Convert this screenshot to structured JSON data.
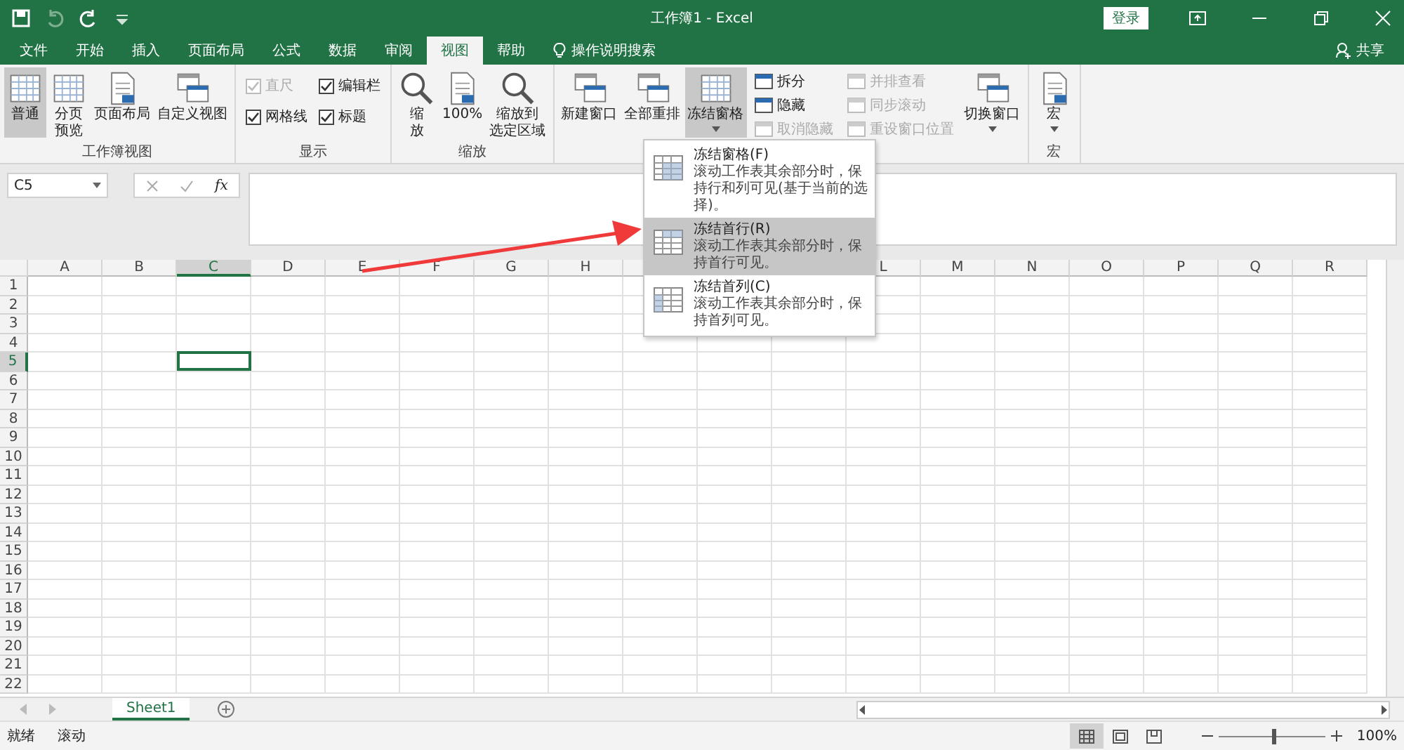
{
  "title_bar": {
    "title": "工作簿1 - Excel",
    "login": "登录"
  },
  "menu_tabs": [
    {
      "label": "文件",
      "selected": false
    },
    {
      "label": "开始",
      "selected": false
    },
    {
      "label": "插入",
      "selected": false
    },
    {
      "label": "页面布局",
      "selected": false
    },
    {
      "label": "公式",
      "selected": false
    },
    {
      "label": "数据",
      "selected": false
    },
    {
      "label": "审阅",
      "selected": false
    },
    {
      "label": "视图",
      "selected": true
    },
    {
      "label": "帮助",
      "selected": false
    }
  ],
  "tell_me": "操作说明搜索",
  "share": "共享",
  "ribbon": {
    "groups": [
      {
        "label": "工作簿视图",
        "items": [
          {
            "kind": "large",
            "label": "普通",
            "selected": true
          },
          {
            "kind": "large",
            "lines": [
              "分页",
              "预览"
            ],
            "selected": false
          },
          {
            "kind": "large",
            "label": "页面布局",
            "selected": false
          },
          {
            "kind": "large",
            "label": "自定义视图",
            "selected": false
          }
        ]
      },
      {
        "label": "显示",
        "items": [
          {
            "kind": "check",
            "label": "直尺",
            "checked": true,
            "disabled": true
          },
          {
            "kind": "check",
            "label": "编辑栏",
            "checked": true,
            "disabled": false
          },
          {
            "kind": "check",
            "label": "网格线",
            "checked": true,
            "disabled": false
          },
          {
            "kind": "check",
            "label": "标题",
            "checked": true,
            "disabled": false
          }
        ]
      },
      {
        "label": "缩放",
        "items": [
          {
            "kind": "large",
            "lines": [
              "缩",
              "放"
            ],
            "selected": false
          },
          {
            "kind": "large",
            "label": "100%",
            "selected": false
          },
          {
            "kind": "large",
            "lines": [
              "缩放到",
              "选定区域"
            ],
            "selected": false
          }
        ]
      },
      {
        "items": [
          {
            "kind": "large",
            "label": "新建窗口",
            "selected": false
          },
          {
            "kind": "large",
            "label": "全部重排",
            "selected": false
          },
          {
            "kind": "large",
            "label": "冻结窗格",
            "selected": true,
            "dropdown": true
          },
          {
            "kind": "stack",
            "items": [
              {
                "label": "拆分",
                "disabled": false
              },
              {
                "label": "隐藏",
                "disabled": false
              },
              {
                "label": "取消隐藏",
                "disabled": true
              }
            ]
          },
          {
            "kind": "stack",
            "items": [
              {
                "label": "并排查看",
                "disabled": true
              },
              {
                "label": "同步滚动",
                "disabled": true
              },
              {
                "label": "重设窗口位置",
                "disabled": true
              }
            ]
          },
          {
            "kind": "large",
            "label": "切换窗口",
            "selected": false,
            "dropdown": true
          }
        ]
      },
      {
        "label": "宏",
        "items": [
          {
            "kind": "large",
            "label": "宏",
            "selected": false,
            "dropdown": true
          }
        ]
      }
    ]
  },
  "formula_bar": {
    "name_box": "C5",
    "function_label": "fx"
  },
  "columns": [
    {
      "label": "A",
      "selected": false
    },
    {
      "label": "B",
      "selected": false
    },
    {
      "label": "C",
      "selected": true
    },
    {
      "label": "D",
      "selected": false
    },
    {
      "label": "E",
      "selected": false
    },
    {
      "label": "F",
      "selected": false
    },
    {
      "label": "G",
      "selected": false
    },
    {
      "label": "H",
      "selected": false
    },
    {},
    {},
    {},
    {
      "label": "L",
      "selected": false
    },
    {
      "label": "M",
      "selected": false
    },
    {
      "label": "N",
      "selected": false
    },
    {
      "label": "O",
      "selected": false
    },
    {
      "label": "P",
      "selected": false
    },
    {
      "label": "Q",
      "selected": false
    },
    {
      "label": "R",
      "selected": false
    }
  ],
  "rows": [
    {
      "label": "1",
      "selected": false
    },
    {
      "label": "2",
      "selected": false
    },
    {
      "label": "3",
      "selected": false
    },
    {
      "label": "4",
      "selected": false
    },
    {
      "label": "5",
      "selected": true
    },
    {
      "label": "6",
      "selected": false
    },
    {
      "label": "7",
      "selected": false
    },
    {
      "label": "8",
      "selected": false
    },
    {
      "label": "9",
      "selected": false
    },
    {
      "label": "10",
      "selected": false
    },
    {
      "label": "11",
      "selected": false
    },
    {
      "label": "12",
      "selected": false
    },
    {
      "label": "13",
      "selected": false
    },
    {
      "label": "14",
      "selected": false
    },
    {
      "label": "15",
      "selected": false
    },
    {
      "label": "16",
      "selected": false
    },
    {
      "label": "17",
      "selected": false
    },
    {
      "label": "18",
      "selected": false
    },
    {
      "label": "19",
      "selected": false
    },
    {
      "label": "20",
      "selected": false
    },
    {
      "label": "21",
      "selected": false
    },
    {
      "label": "22",
      "selected": false
    }
  ],
  "freeze_menu": [
    {
      "title": "冻结窗格(F)",
      "description": "滚动工作表其余部分时，保持行和列可见(基于当前的选择)。",
      "selected": false
    },
    {
      "title": "冻结首行(R)",
      "description": "滚动工作表其余部分时，保持首行可见。",
      "selected": true
    },
    {
      "title": "冻结首列(C)",
      "description": "滚动工作表其余部分时，保持首列可见。",
      "selected": false
    }
  ],
  "sheet_tabs": [
    {
      "label": "Sheet1",
      "selected": true
    }
  ],
  "status_bar": {
    "texts": [
      "就绪",
      "滚动"
    ],
    "view_modes": [
      {
        "selected": true
      },
      {
        "selected": false
      },
      {
        "selected": false
      }
    ],
    "zoom": {
      "level": 0.5,
      "reading": "100%"
    }
  }
}
